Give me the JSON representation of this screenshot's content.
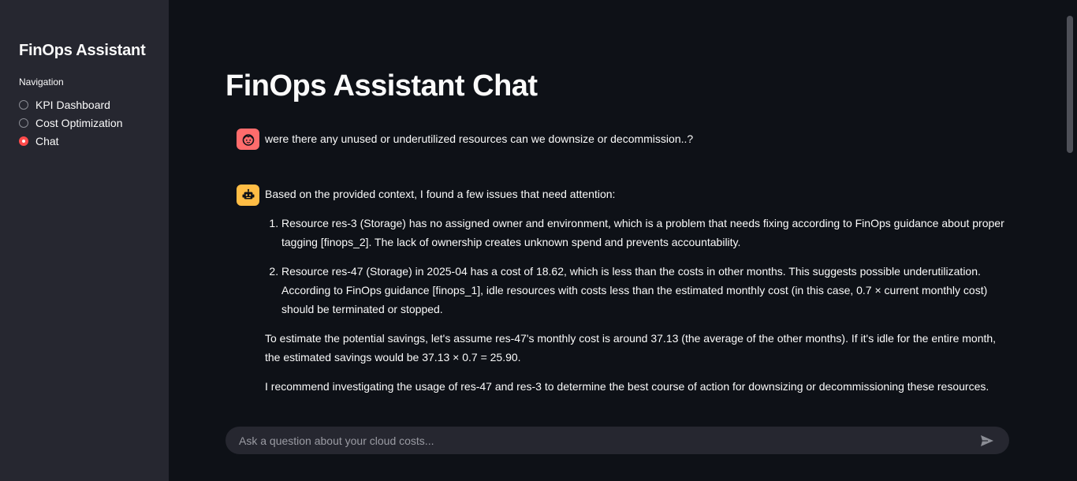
{
  "sidebar": {
    "title": "FinOps Assistant",
    "nav_label": "Navigation",
    "items": [
      {
        "label": "KPI Dashboard",
        "selected": false
      },
      {
        "label": "Cost Optimization",
        "selected": false
      },
      {
        "label": "Chat",
        "selected": true
      }
    ]
  },
  "main": {
    "title": "FinOps Assistant Chat"
  },
  "messages": {
    "user": {
      "text": "were there any unused or underutilized resources can we downsize or decommission..?",
      "avatar_icon": "user-face-icon"
    },
    "assistant": {
      "avatar_icon": "robot-icon",
      "intro": "Based on the provided context, I found a few issues that need attention:",
      "points": [
        "Resource res-3 (Storage) has no assigned owner and environment, which is a problem that needs fixing according to FinOps guidance about proper tagging [finops_2]. The lack of ownership creates unknown spend and prevents accountability.",
        "Resource res-47 (Storage) in 2025-04 has a cost of 18.62, which is less than the costs in other months. This suggests possible underutilization. According to FinOps guidance [finops_1], idle resources with costs less than the estimated monthly cost (in this case, 0.7 × current monthly cost) should be terminated or stopped."
      ],
      "savings": "To estimate the potential savings, let's assume res-47's monthly cost is around 37.13 (the average of the other months). If it's idle for the entire month, the estimated savings would be 37.13 × 0.7 = 25.90.",
      "recommendation": "I recommend investigating the usage of res-47 and res-3 to determine the best course of action for downsizing or decommissioning these resources."
    }
  },
  "chat_input": {
    "placeholder": "Ask a question about your cloud costs...",
    "value": "",
    "send_icon": "send-icon"
  },
  "colors": {
    "background": "#0e1117",
    "sidebar": "#262730",
    "accent": "#ff4b4b",
    "user_avatar": "#ff6c6c",
    "assistant_avatar": "#ffbd45"
  }
}
